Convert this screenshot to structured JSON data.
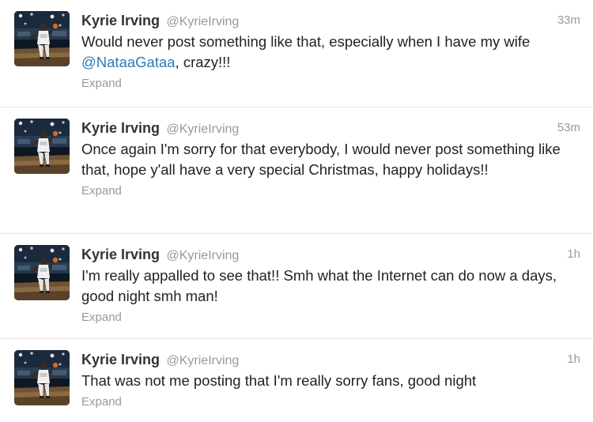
{
  "tweets": [
    {
      "name": "Kyrie Irving",
      "handle": "@KyrieIrving",
      "time": "33m",
      "text_before": "Would never post something like that, especially when I have my wife ",
      "mention": "@NataaGataa",
      "text_after": ", crazy!!!",
      "expand": "Expand"
    },
    {
      "name": "Kyrie Irving",
      "handle": "@KyrieIrving",
      "time": "53m",
      "text": "Once again I'm sorry for that everybody, I would never post something like that, hope y'all have a very special Christmas, happy holidays!!",
      "expand": "Expand"
    },
    {
      "name": "Kyrie Irving",
      "handle": "@KyrieIrving",
      "time": "1h",
      "text": "I'm really appalled to see that!! Smh what the Internet can do now a days, good night smh man!",
      "expand": "Expand"
    },
    {
      "name": "Kyrie Irving",
      "handle": "@KyrieIrving",
      "time": "1h",
      "text": "That was not me posting that I'm really sorry fans, good night",
      "expand": "Expand"
    }
  ],
  "colors": {
    "name": "#333333",
    "meta": "#999999",
    "text": "#222222",
    "mention": "#2b7bb9",
    "divider": "#e6e6e6"
  },
  "icons": {
    "avatar": "profile-photo-basketball-player"
  }
}
